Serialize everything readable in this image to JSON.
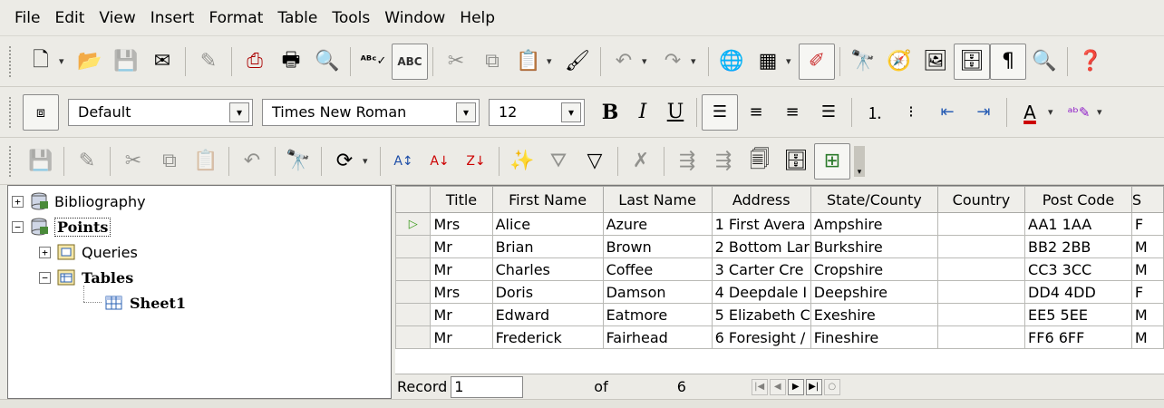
{
  "menu": [
    "File",
    "Edit",
    "View",
    "Insert",
    "Format",
    "Table",
    "Tools",
    "Window",
    "Help"
  ],
  "format_bar": {
    "style": "Default",
    "font": "Times New Roman",
    "size": "12",
    "bold": "B",
    "italic": "I",
    "underline": "U"
  },
  "tree": {
    "items": [
      {
        "label": "Bibliography",
        "expander": "+"
      },
      {
        "label": "Points",
        "expander": "−"
      },
      {
        "label": "Queries",
        "expander": "+"
      },
      {
        "label": "Tables",
        "expander": "−"
      },
      {
        "label": "Sheet1"
      }
    ]
  },
  "grid": {
    "headers": [
      "Title",
      "First Name",
      "Last Name",
      "Address",
      "State/County",
      "Country",
      "Post Code",
      "S"
    ],
    "rows": [
      [
        "Mrs",
        "Alice",
        "Azure",
        "1 First Avera",
        "Ampshire",
        "",
        "AA1 1AA",
        "F"
      ],
      [
        "Mr",
        "Brian",
        "Brown",
        "2 Bottom Lar",
        "Burkshire",
        "",
        "BB2 2BB",
        "M"
      ],
      [
        "Mr",
        "Charles",
        "Coffee",
        "3 Carter Cre",
        "Cropshire",
        "",
        "CC3 3CC",
        "M"
      ],
      [
        "Mrs",
        "Doris",
        "Damson",
        "4 Deepdale I",
        "Deepshire",
        "",
        "DD4 4DD",
        "F"
      ],
      [
        "Mr",
        "Edward",
        "Eatmore",
        "5 Elizabeth C",
        "Exeshire",
        "",
        "EE5 5EE",
        "M"
      ],
      [
        "Mr",
        "Frederick",
        "Fairhead",
        "6 Foresight /",
        "Fineshire",
        "",
        "FF6 6FF",
        "M"
      ]
    ]
  },
  "nav": {
    "record_label": "Record",
    "current": "1",
    "of_label": "of",
    "total": "6"
  },
  "colors": {
    "current_row_marker": "#3a9a1a"
  }
}
